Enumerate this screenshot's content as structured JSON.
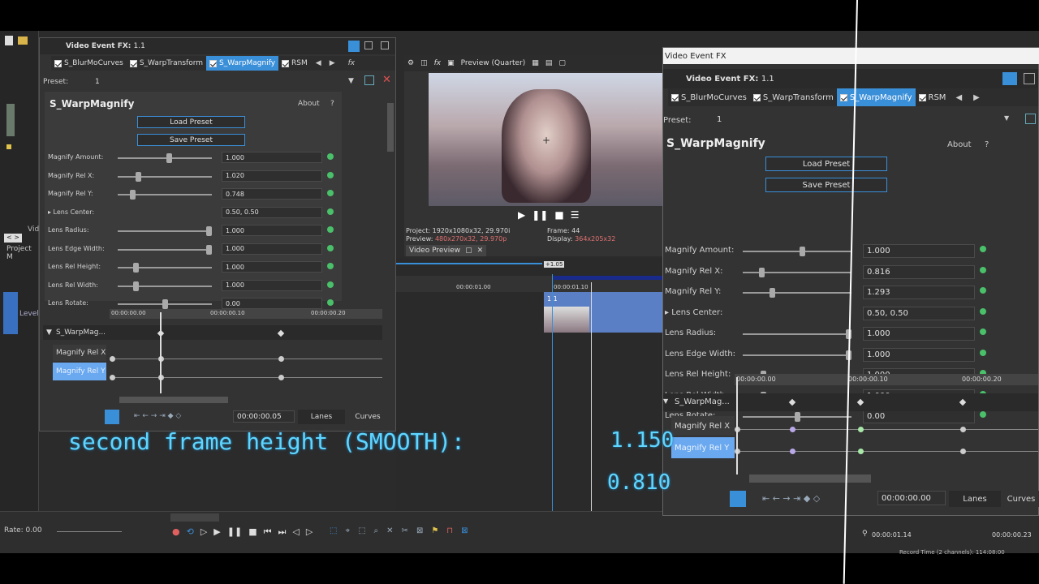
{
  "left_fx": {
    "title": "Video Event FX:",
    "event": "1.1",
    "tabs": [
      "S_BlurMoCurves",
      "S_WarpTransform",
      "S_WarpMagnify",
      "RSM"
    ],
    "preset_label": "Preset:",
    "preset_value": "1",
    "plugin_name": "S_WarpMagnify",
    "about": "About",
    "help": "?",
    "load_preset": "Load Preset",
    "save_preset": "Save Preset",
    "params": [
      {
        "label": "Magnify Amount:",
        "value": "1.000",
        "level": 0.55
      },
      {
        "label": "Magnify Rel X:",
        "value": "1.020",
        "level": 0.2
      },
      {
        "label": "Magnify Rel Y:",
        "value": "0.748",
        "level": 0.14
      },
      {
        "label": "Lens Center:",
        "value": "0.50, 0.50",
        "level": null
      },
      {
        "label": "Lens Radius:",
        "value": "1.000",
        "level": 1.0
      },
      {
        "label": "Lens Edge Width:",
        "value": "1.000",
        "level": 1.0
      },
      {
        "label": "Lens Rel Height:",
        "value": "1.000",
        "level": 0.17
      },
      {
        "label": "Lens Rel Width:",
        "value": "1.000",
        "level": 0.17
      },
      {
        "label": "Lens Rotate:",
        "value": "0.00",
        "level": 0.5
      }
    ],
    "timeline_times": [
      "00:00:00.00",
      "00:00:00.10",
      "00:00:00.20"
    ],
    "track_main": "S_WarpMag...",
    "track_x": "Magnify Rel X",
    "track_y": "Magnify Rel Y",
    "time_value": "00:00:00.05",
    "lanes": "Lanes",
    "curves": "Curves"
  },
  "preview": {
    "mode": "Preview (Quarter)",
    "project_label": "Project:",
    "project_value": "1920x1080x32, 29.970i",
    "preview_label": "Preview:",
    "preview_value": "480x270x32, 29.970p",
    "frame_label": "Frame:",
    "frame_value": "44",
    "display_label": "Display:",
    "display_value": "364x205x32",
    "tab_label": "Video Preview"
  },
  "timeline": {
    "time_a": "00:00:01.00",
    "time_b": "00:00:01.10",
    "marker": "+1.05",
    "clip_label": "1.1",
    "level_label": "Level",
    "project_media": "Project M",
    "video_label": "Vid",
    "rate": "Rate: 0.00",
    "current_time": "00:00:01.14",
    "end_time": "00:00:00.23",
    "record_time": "Record Time (2 channels): 114:08:00"
  },
  "right_fx": {
    "window_title": "Video Event FX",
    "title": "Video Event FX:",
    "event": "1.1",
    "tabs": [
      "S_BlurMoCurves",
      "S_WarpTransform",
      "S_WarpMagnify",
      "RSM"
    ],
    "preset_label": "Preset:",
    "preset_value": "1",
    "plugin_name": "S_WarpMagnify",
    "about": "About",
    "help": "?",
    "load_preset": "Load Preset",
    "save_preset": "Save Preset",
    "params": [
      {
        "label": "Magnify Amount:",
        "value": "1.000",
        "level": 0.55
      },
      {
        "label": "Magnify Rel X:",
        "value": "0.816",
        "level": 0.16
      },
      {
        "label": "Magnify Rel Y:",
        "value": "1.293",
        "level": 0.26
      },
      {
        "label": "Lens Center:",
        "value": "0.50, 0.50",
        "level": null
      },
      {
        "label": "Lens Radius:",
        "value": "1.000",
        "level": 1.0
      },
      {
        "label": "Lens Edge Width:",
        "value": "1.000",
        "level": 1.0
      },
      {
        "label": "Lens Rel Height:",
        "value": "1.000",
        "level": 0.17
      },
      {
        "label": "Lens Rel Width:",
        "value": "1.000",
        "level": 0.17
      },
      {
        "label": "Lens Rotate:",
        "value": "0.00",
        "level": 0.5
      }
    ],
    "timeline_times": [
      "00:00:00.00",
      "00:00:00.10",
      "00:00:00.20"
    ],
    "track_main": "S_WarpMag...",
    "track_x": "Magnify Rel X",
    "track_y": "Magnify Rel Y",
    "time_value": "00:00:00.00",
    "lanes": "Lanes",
    "curves": "Curves"
  },
  "caption": {
    "line1": "second frame height (SMOOTH):",
    "value1": "1.150",
    "value2": "0.810"
  },
  "colors": {
    "accent": "#3a8fd9",
    "caption": "#5fd6ff",
    "clip": "#5b7fc4"
  }
}
